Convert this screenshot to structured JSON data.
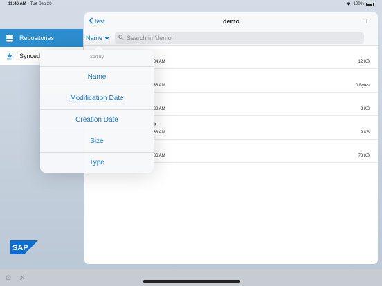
{
  "status_bar": {
    "time": "11:46 AM",
    "date": "Tue Sep 26",
    "battery": "100%"
  },
  "sidebar": {
    "items": [
      {
        "label": "Repositories",
        "icon": "repository-stack-icon"
      },
      {
        "label": "Synced",
        "icon": "download-icon"
      }
    ],
    "logo": "SAP"
  },
  "nav": {
    "back_label": "test",
    "title": "demo",
    "add_icon": "plus-icon"
  },
  "search": {
    "sort_label": "Name",
    "placeholder": "Search in 'demo'"
  },
  "files": [
    {
      "name": "",
      "date": ":34 AM",
      "size": "12 KB"
    },
    {
      "name": "",
      "date": ":36 AM",
      "size": "0 Bytes"
    },
    {
      "name": "",
      "date": ":33 AM",
      "size": "3 KB"
    },
    {
      "name": "k",
      "date": ":33 AM",
      "size": "9 KB"
    },
    {
      "name": "",
      "date": ":36 AM",
      "size": "78 KB"
    }
  ],
  "sort_popover": {
    "title": "Sort By",
    "options": [
      "Name",
      "Modification Date",
      "Creation Date",
      "Size",
      "Type"
    ]
  },
  "colors": {
    "accent": "#1a78c8",
    "sidebar_active": "#2d8ecf",
    "sap_blue": "#0a6ed1"
  }
}
